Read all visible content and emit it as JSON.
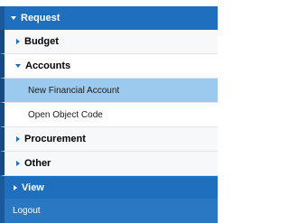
{
  "menu": {
    "request": {
      "label": "Request",
      "icon": "chevron-down-icon",
      "expanded": true
    },
    "budget": {
      "label": "Budget",
      "icon": "chevron-right-icon",
      "expanded": false
    },
    "accounts": {
      "label": "Accounts",
      "icon": "chevron-down-icon",
      "expanded": true,
      "items": [
        {
          "label": "New Financial Account",
          "selected": true
        },
        {
          "label": "Open Object Code",
          "selected": false
        }
      ]
    },
    "procurement": {
      "label": "Procurement",
      "icon": "chevron-right-icon",
      "expanded": false
    },
    "other": {
      "label": "Other",
      "icon": "chevron-right-icon",
      "expanded": false
    },
    "view": {
      "label": "View",
      "icon": "chevron-right-icon",
      "expanded": false
    },
    "logout": {
      "label": "Logout"
    }
  },
  "colors": {
    "header_blue": "#1f6fbf",
    "selected_item": "#9cc9ee",
    "left_accent": "#174a82",
    "submenu_bg": "#f7f8fa"
  }
}
